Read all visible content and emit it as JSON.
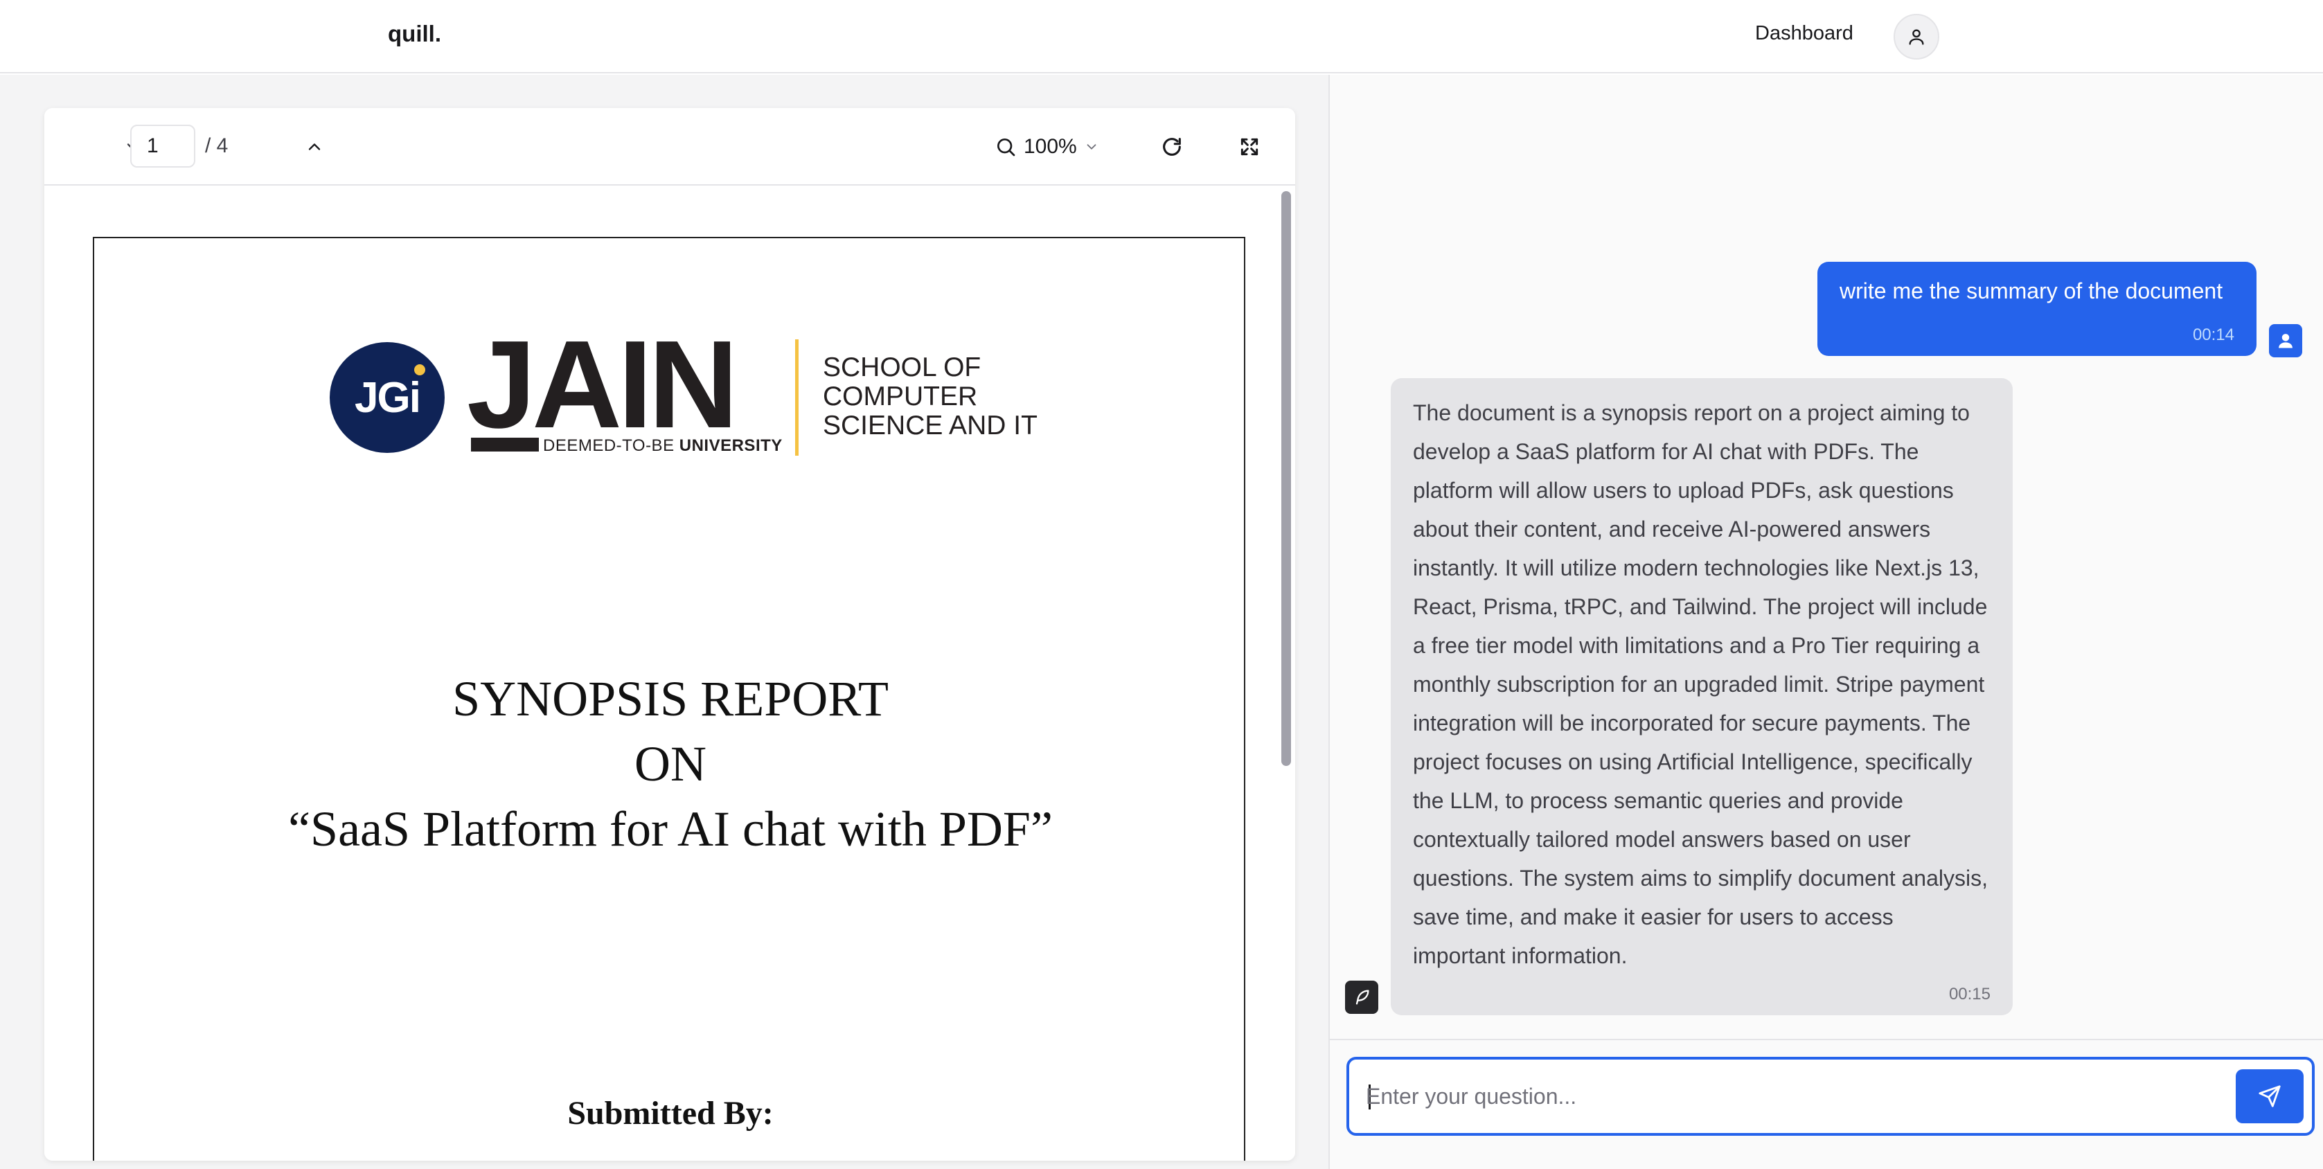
{
  "navbar": {
    "brand": "quill.",
    "dashboard_label": "Dashboard",
    "avatar_icon": "user-icon"
  },
  "viewer": {
    "page_current": "1",
    "page_total": "/ 4",
    "zoom": "100%",
    "icons": {
      "prev_page": "chevron-down-icon",
      "next_page": "chevron-up-icon",
      "zoom": "search-icon",
      "zoom_dropdown": "chevron-down-icon",
      "rotate": "rotate-icon",
      "fullscreen": "fullscreen-icon"
    }
  },
  "pdf": {
    "logo_text": "JGi",
    "logo_wordmark": "JAIN",
    "logo_sub_prefix": "DEEMED-TO-BE ",
    "logo_sub_bold": "UNIVERSITY",
    "school_line1": "SCHOOL OF",
    "school_line2": "COMPUTER",
    "school_line3": "SCIENCE AND IT",
    "title_line1": "SYNOPSIS REPORT",
    "title_line2": "ON",
    "title_line3": "“SaaS Platform for AI chat with PDF”",
    "submitted_by": "Submitted By:"
  },
  "chat": {
    "messages": [
      {
        "role": "user",
        "text": "write me the summary of the document",
        "time": "00:14"
      },
      {
        "role": "assistant",
        "text": "The document is a synopsis report on a project aiming to develop a SaaS platform for AI chat with PDFs. The platform will allow users to upload PDFs, ask questions about their content, and receive AI-powered answers instantly. It will utilize modern technologies like Next.js 13, React, Prisma, tRPC, and Tailwind. The project will include a free tier model with limitations and a Pro Tier requiring a monthly subscription for an upgraded limit. Stripe payment integration will be incorporated for secure payments. The project focuses on using Artificial Intelligence, specifically the LLM, to process semantic queries and provide contextually tailored model answers based on user questions. The system aims to simplify document analysis, save time, and make it easier for users to access important information.",
        "time": "00:15"
      }
    ],
    "input_placeholder": "Enter your question...",
    "send_icon": "send-icon"
  },
  "colors": {
    "accent": "#2563eb",
    "assistant_bubble": "#e4e4e7",
    "jain_navy": "#0f2356",
    "jain_yellow": "#f5c242"
  }
}
